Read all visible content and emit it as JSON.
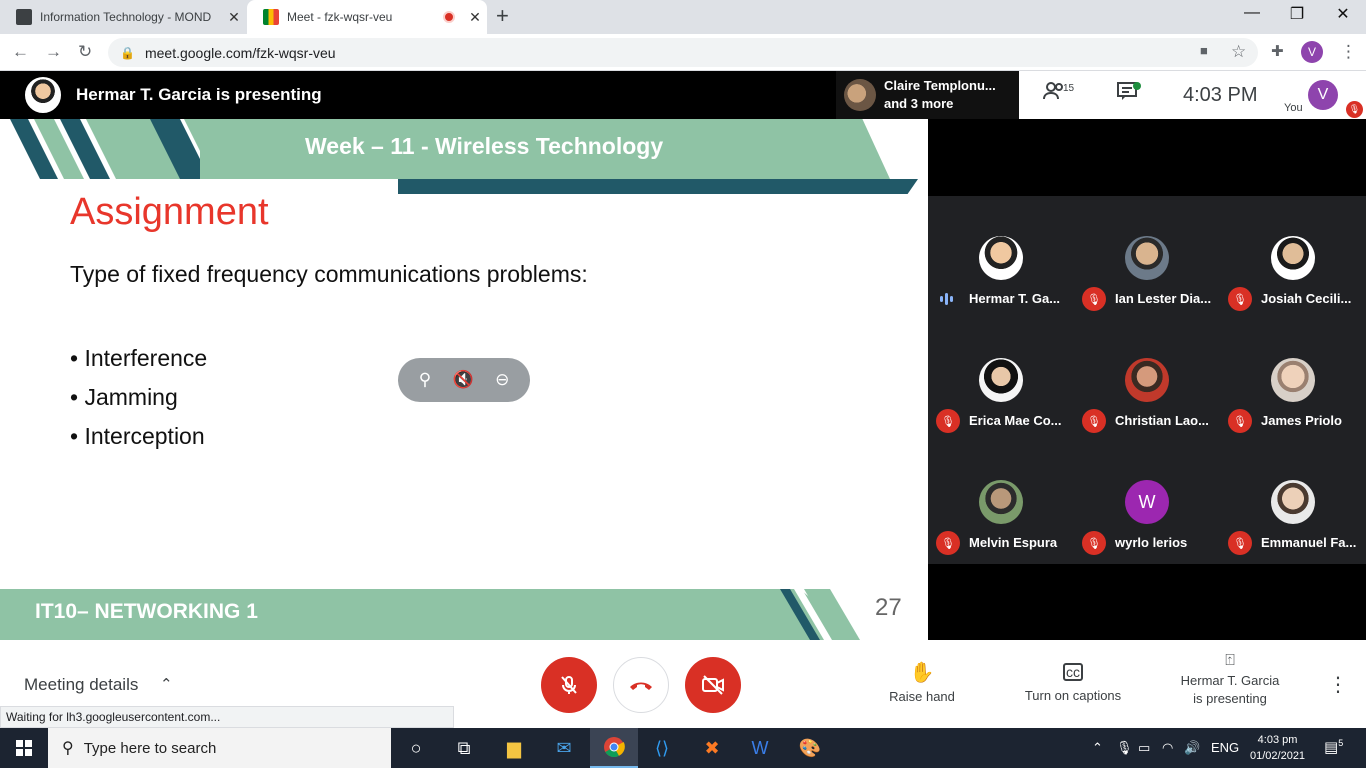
{
  "browser": {
    "tabs": [
      {
        "title": "Information Technology - MOND",
        "active": false
      },
      {
        "title": "Meet - fzk-wqsr-veu",
        "active": true,
        "recording": true
      }
    ],
    "url": "meet.google.com/fzk-wqsr-veu",
    "profile_initial": "V",
    "window_controls": {
      "minimize": "—",
      "restore": "❐",
      "close": "✕"
    }
  },
  "meet": {
    "presenting_text": "Hermar T. Garcia is presenting",
    "mini_tile": {
      "line1": "Claire Templonu...",
      "line2": "and 3 more"
    },
    "people_count": "15",
    "time": "4:03  PM",
    "you_label": "You",
    "you_initial": "V"
  },
  "slide": {
    "title": "Week – 11 - Wireless Technology",
    "heading": "Assignment",
    "subheading": "Type of fixed frequency communications problems:",
    "bullets": [
      "Interference",
      "Jamming",
      "Interception"
    ],
    "footer": "IT10– NETWORKING 1",
    "page_number": "27"
  },
  "participants": [
    {
      "name": "Hermar T. Ga...",
      "muted": false,
      "speaking": true,
      "avatar": "photo",
      "color": "#e9d2b8"
    },
    {
      "name": "Ian Lester Dia...",
      "muted": true,
      "avatar": "photo",
      "color": "#c8b09a"
    },
    {
      "name": "Josiah Cecili...",
      "muted": true,
      "avatar": "photo",
      "color": "#d9c1a6"
    },
    {
      "name": "Erica Mae Co...",
      "muted": true,
      "avatar": "photo",
      "color": "#e2c3a8"
    },
    {
      "name": "Christian Lao...",
      "muted": true,
      "avatar": "photo",
      "color": "#c77a63"
    },
    {
      "name": "James Priolo",
      "muted": true,
      "avatar": "photo",
      "color": "#e6c8b0"
    },
    {
      "name": "Melvin Espura",
      "muted": true,
      "avatar": "photo",
      "color": "#b69a80"
    },
    {
      "name": "wyrlo lerios",
      "muted": true,
      "avatar": "letter",
      "letter": "W",
      "color": "#9c27b0"
    },
    {
      "name": "Emmanuel Fa...",
      "muted": true,
      "avatar": "photo",
      "color": "#e8cdb6"
    }
  ],
  "bottom": {
    "meeting_details": "Meeting details",
    "raise_hand": "Raise hand",
    "captions": "Turn on captions",
    "presenting_line1": "Hermar T. Garcia",
    "presenting_line2": "is presenting",
    "status_text": "Waiting for lh3.googleusercontent.com..."
  },
  "taskbar": {
    "search_placeholder": "Type here to search",
    "lang": "ENG",
    "time": "4:03 pm",
    "date": "01/02/2021",
    "notifications": "5"
  },
  "colors": {
    "accent_red": "#d93025",
    "slide_green": "#8fc3a5",
    "slide_teal": "#215968",
    "assignment_red": "#e8362b",
    "panel_bg": "#202124"
  }
}
